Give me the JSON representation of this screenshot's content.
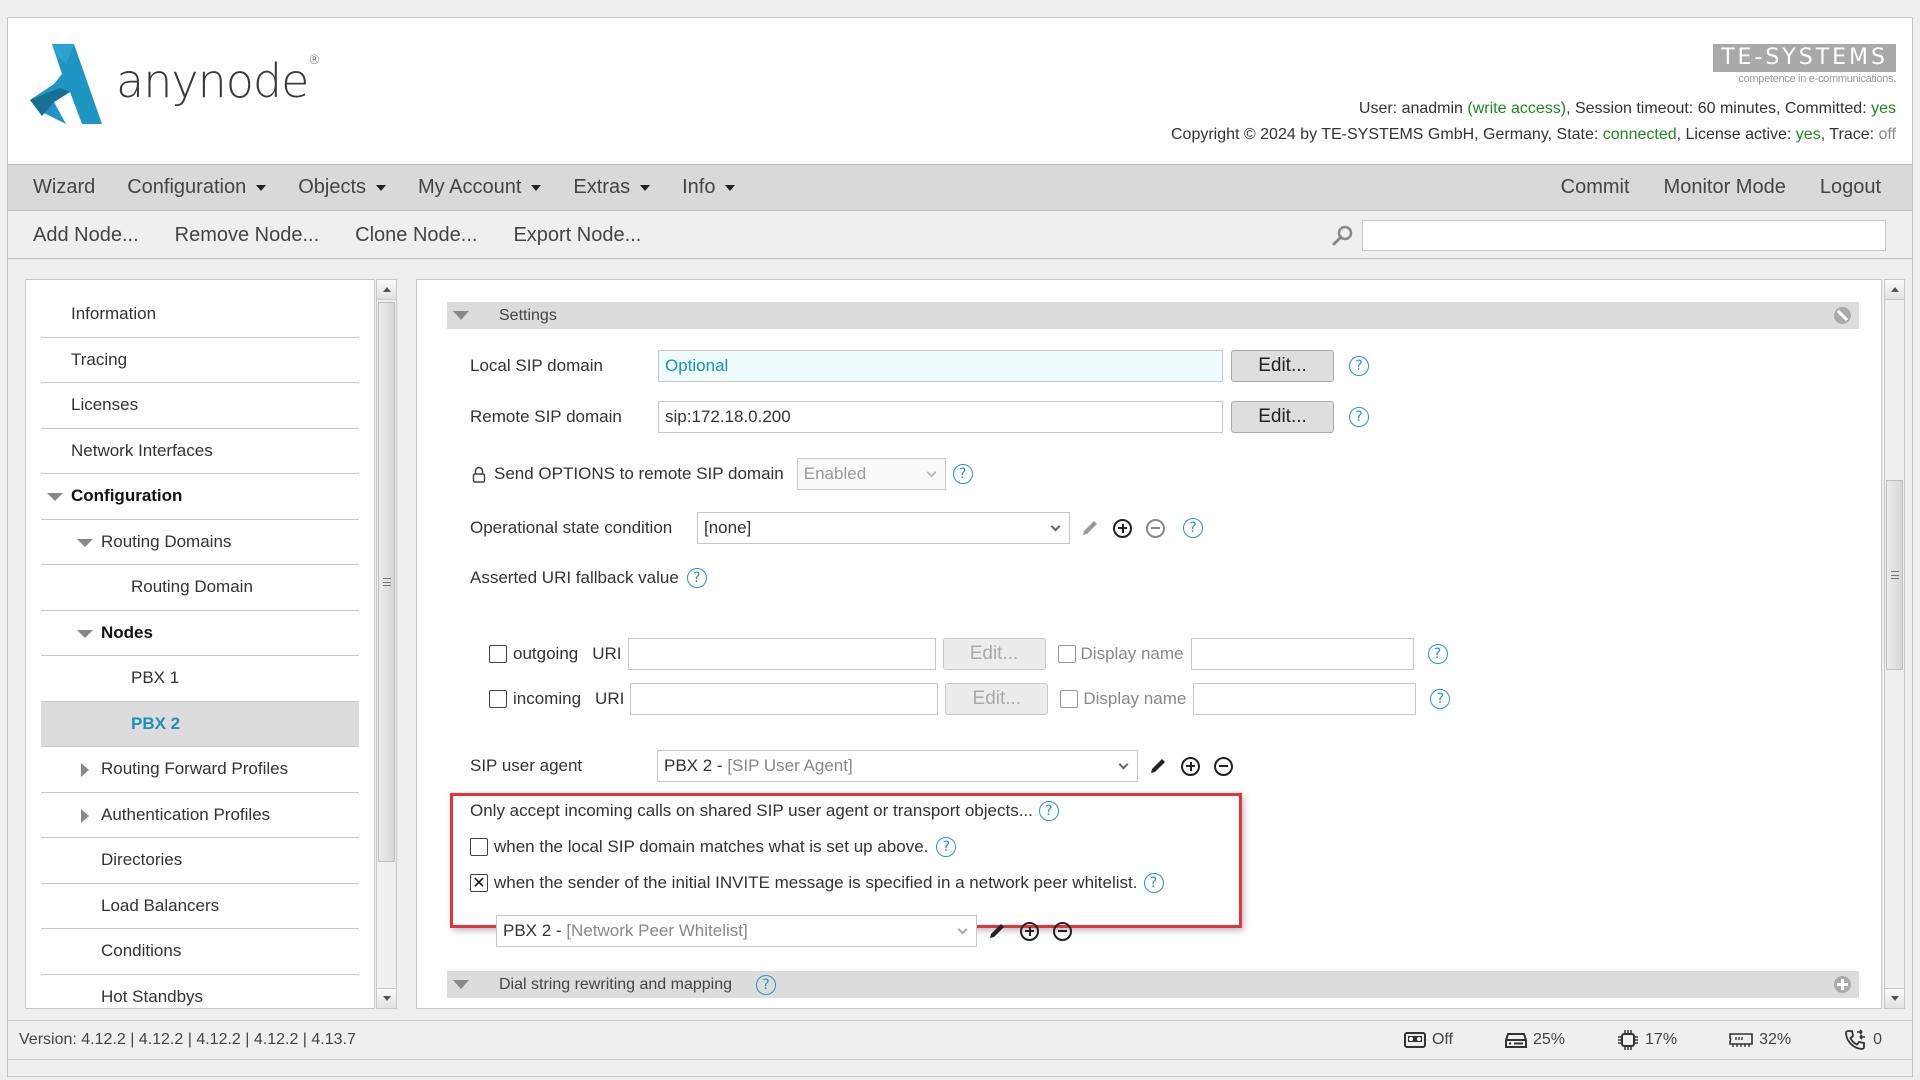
{
  "header": {
    "logo_text": "anynode",
    "logo_reg": "®",
    "brand_logo": "TE-SYSTEMS",
    "brand_tagline": "competence in e-communications.",
    "status_line1": {
      "user_label": "User: anadmin ",
      "access": "(write access)",
      "session": ", Session timeout: 60 minutes, Committed: ",
      "committed": "yes"
    },
    "status_line2": {
      "copyright": "Copyright © 2024 by TE-SYSTEMS GmbH, Germany, State: ",
      "state": "connected",
      "license_label": ", License active: ",
      "license": "yes",
      "trace_label": ", Trace: ",
      "trace": "off"
    },
    "colors": {
      "ok_green": "#1c8a1c",
      "accent_blue": "#1e8fb8",
      "logo_blue": "#1e95c2",
      "highlight_red": "#e5323b"
    }
  },
  "menubar": {
    "items": [
      {
        "label": "Wizard",
        "dropdown": false
      },
      {
        "label": "Configuration",
        "dropdown": true
      },
      {
        "label": "Objects",
        "dropdown": true
      },
      {
        "label": "My Account",
        "dropdown": true
      },
      {
        "label": "Extras",
        "dropdown": true
      },
      {
        "label": "Info",
        "dropdown": true
      }
    ],
    "right": [
      "Commit",
      "Monitor Mode",
      "Logout"
    ]
  },
  "toolbar": {
    "items": [
      "Add Node...",
      "Remove Node...",
      "Clone Node...",
      "Export Node..."
    ],
    "search_value": ""
  },
  "sidebar": {
    "items": [
      {
        "label": "Information"
      },
      {
        "label": "Tracing"
      },
      {
        "label": "Licenses"
      },
      {
        "label": "Network Interfaces"
      },
      {
        "label": "Configuration",
        "expanded": true
      },
      {
        "label": "Routing Domains",
        "expanded": true
      },
      {
        "label": "Routing Domain"
      },
      {
        "label": "Nodes",
        "expanded": true
      },
      {
        "label": "PBX 1"
      },
      {
        "label": "PBX 2",
        "selected": true
      },
      {
        "label": "Routing Forward Profiles",
        "expanded": false
      },
      {
        "label": "Authentication Profiles",
        "expanded": false
      },
      {
        "label": "Directories"
      },
      {
        "label": "Load Balancers"
      },
      {
        "label": "Conditions"
      },
      {
        "label": "Hot Standbys"
      }
    ]
  },
  "settings": {
    "section_title": "Settings",
    "local_sip_domain": {
      "label": "Local SIP domain",
      "value": "Optional",
      "edit": "Edit..."
    },
    "remote_sip_domain": {
      "label": "Remote SIP domain",
      "value": "sip:172.18.0.200",
      "edit": "Edit..."
    },
    "send_options": {
      "label": "Send OPTIONS to remote SIP domain",
      "value": "Enabled"
    },
    "op_state": {
      "label": "Operational state condition",
      "value": "[none]"
    },
    "asserted_uri": {
      "label": "Asserted URI fallback value"
    },
    "outgoing": {
      "label": "outgoing",
      "uri_label": "URI",
      "uri_value": "",
      "edit": "Edit...",
      "display_label": "Display name",
      "display_value": "",
      "checked": false
    },
    "incoming": {
      "label": "incoming",
      "uri_label": "URI",
      "uri_value": "",
      "edit": "Edit...",
      "display_label": "Display name",
      "display_value": "",
      "checked": false
    },
    "sip_user_agent": {
      "label": "SIP user agent",
      "value_prefix": "PBX 2 - ",
      "value_type": "[SIP User Agent]"
    },
    "accept": {
      "heading": "Only accept incoming calls on shared SIP user agent or transport objects...",
      "opt1": {
        "label": "when the local SIP domain matches what is set up above.",
        "checked": false
      },
      "opt2": {
        "label": "when the sender of the initial INVITE message is specified in a network peer whitelist.",
        "checked": true,
        "mark": "✕"
      },
      "whitelist_prefix": "PBX 2 - ",
      "whitelist_type": "[Network Peer Whitelist]"
    }
  },
  "dial_section": {
    "title": "Dial string rewriting and mapping"
  },
  "footer": {
    "version": "Version: 4.12.2 | 4.12.2 | 4.12.2 | 4.12.2 | 4.13.7",
    "recording": "Off",
    "disk": "25%",
    "cpu": "17%",
    "memory": "32%",
    "calls": "0"
  },
  "help_glyph": "?"
}
